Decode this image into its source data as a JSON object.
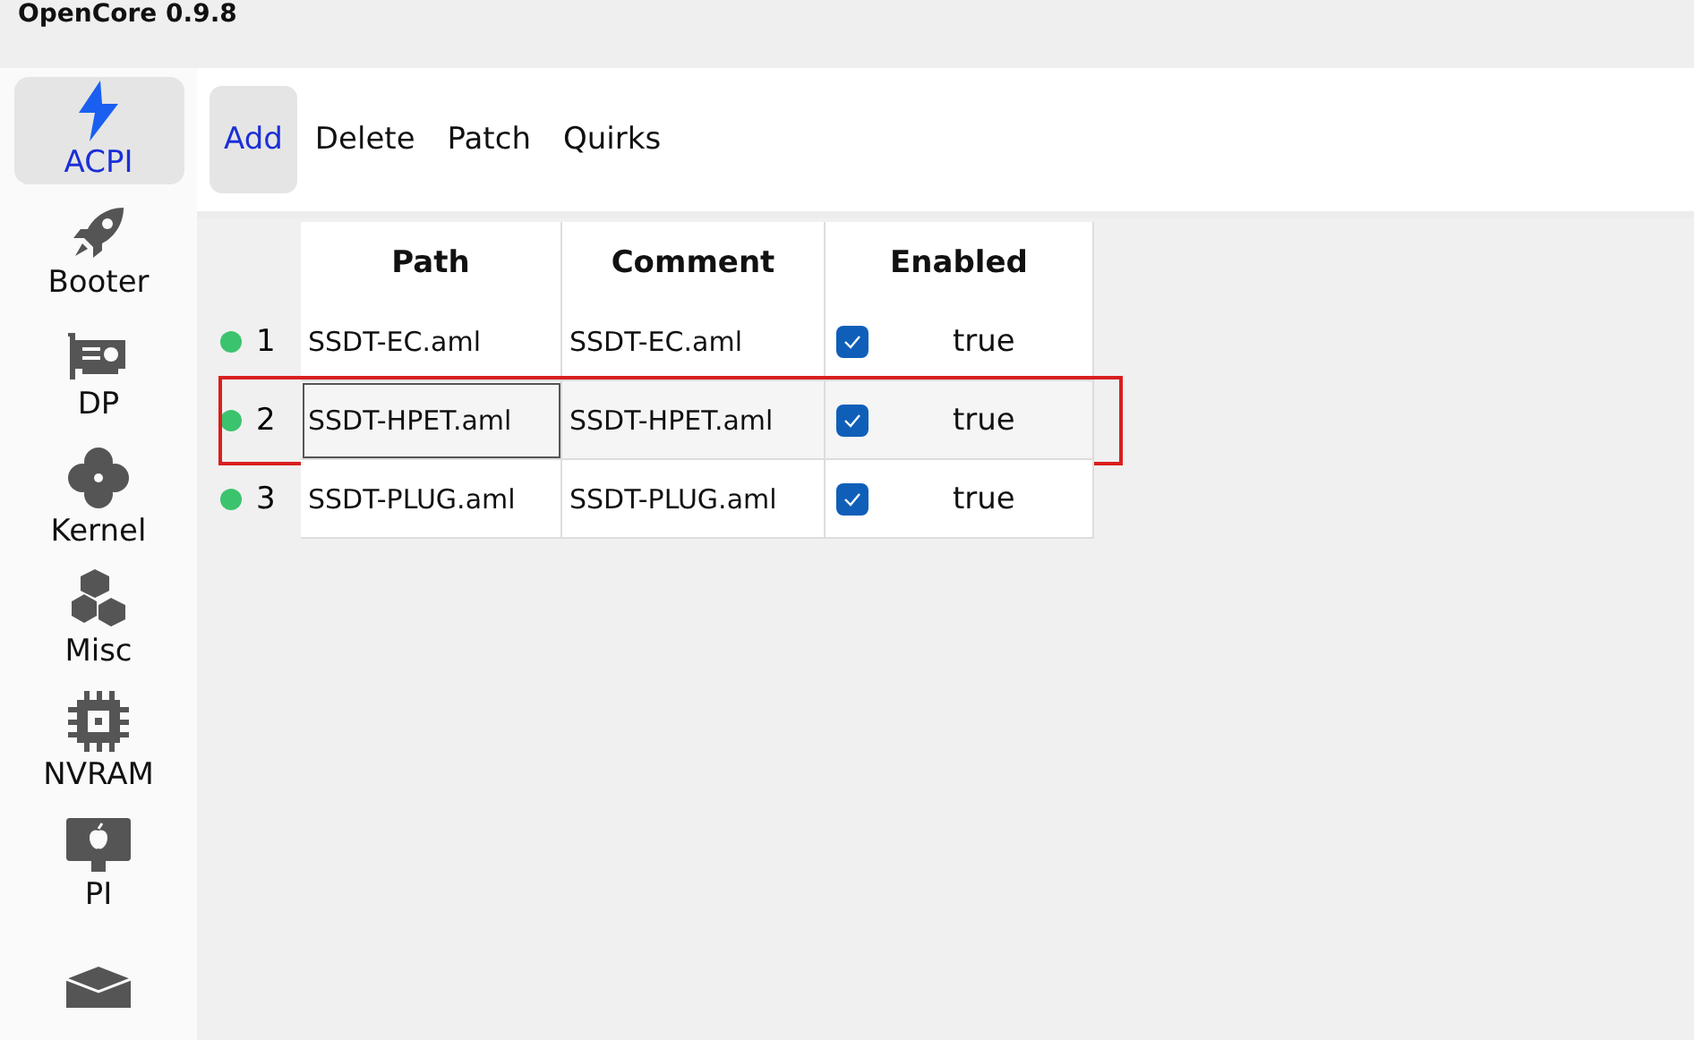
{
  "window": {
    "title": "OpenCore 0.9.8"
  },
  "sidebar": {
    "items": [
      {
        "label": "ACPI",
        "selected": true
      },
      {
        "label": "Booter",
        "selected": false
      },
      {
        "label": "DP",
        "selected": false
      },
      {
        "label": "Kernel",
        "selected": false
      },
      {
        "label": "Misc",
        "selected": false
      },
      {
        "label": "NVRAM",
        "selected": false
      },
      {
        "label": "PI",
        "selected": false
      },
      {
        "selected": false
      }
    ]
  },
  "tabs": [
    {
      "label": "Add",
      "selected": true
    },
    {
      "label": "Delete",
      "selected": false
    },
    {
      "label": "Patch",
      "selected": false
    },
    {
      "label": "Quirks",
      "selected": false
    }
  ],
  "table": {
    "columns": [
      "Path",
      "Comment",
      "Enabled"
    ],
    "rows": [
      {
        "index": "1",
        "path": "SSDT-EC.aml",
        "comment": "SSDT-EC.aml",
        "checked": true,
        "enabled": "true",
        "selected": false,
        "highlighted": false
      },
      {
        "index": "2",
        "path": "SSDT-HPET.aml",
        "comment": "SSDT-HPET.aml",
        "checked": true,
        "enabled": "true",
        "selected": true,
        "highlighted": true
      },
      {
        "index": "3",
        "path": "SSDT-PLUG.aml",
        "comment": "SSDT-PLUG.aml",
        "checked": true,
        "enabled": "true",
        "selected": false,
        "highlighted": false
      }
    ]
  }
}
